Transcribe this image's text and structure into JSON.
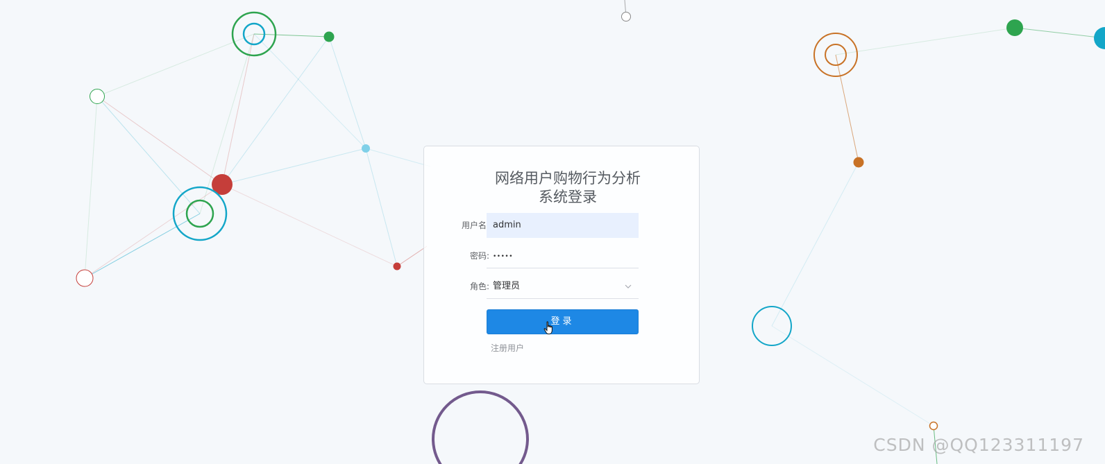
{
  "login": {
    "title_line1": "网络用户购物行为分析",
    "title_line2": "系统登录",
    "username_label": "用户名:",
    "username_value": "admin",
    "password_label": "密码:",
    "password_value": "•••••",
    "role_label": "角色:",
    "role_value": "管理员",
    "login_button": "登录",
    "register_link": "注册用户"
  },
  "watermark": "CSDN @QQ123311197",
  "colors": {
    "primary": "#1e88e5",
    "input_autofill": "#e8f0fe",
    "green": "#2ea44f",
    "cyan": "#13a6c8",
    "red": "#c53e3a",
    "orange": "#c87226",
    "purple": "#735a8d"
  }
}
